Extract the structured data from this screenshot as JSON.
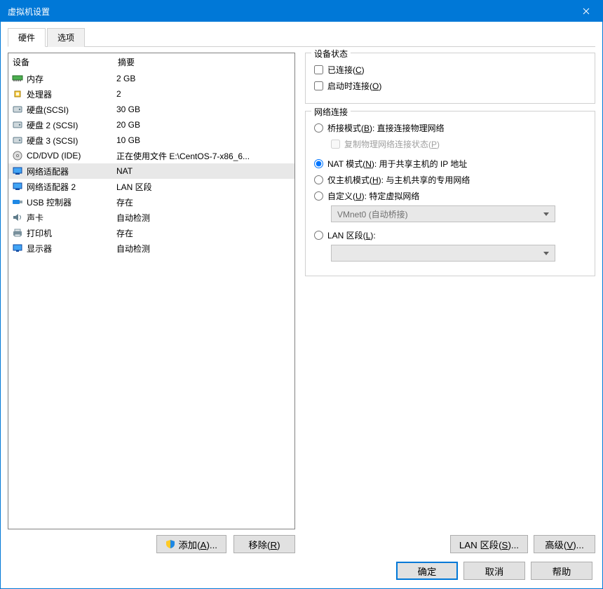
{
  "window": {
    "title": "虚拟机设置"
  },
  "tabs": {
    "hardware": "硬件",
    "options": "选项"
  },
  "list": {
    "header_device": "设备",
    "header_summary": "摘要",
    "rows": [
      {
        "icon": "memory",
        "device": "内存",
        "summary": "2 GB"
      },
      {
        "icon": "cpu",
        "device": "处理器",
        "summary": "2"
      },
      {
        "icon": "disk",
        "device": "硬盘(SCSI)",
        "summary": "30 GB"
      },
      {
        "icon": "disk",
        "device": "硬盘 2 (SCSI)",
        "summary": "20 GB"
      },
      {
        "icon": "disk",
        "device": "硬盘 3 (SCSI)",
        "summary": "10 GB"
      },
      {
        "icon": "cd",
        "device": "CD/DVD (IDE)",
        "summary": "正在使用文件 E:\\CentOS-7-x86_6..."
      },
      {
        "icon": "net",
        "device": "网络适配器",
        "summary": "NAT"
      },
      {
        "icon": "net",
        "device": "网络适配器 2",
        "summary": "LAN 区段"
      },
      {
        "icon": "usb",
        "device": "USB 控制器",
        "summary": "存在"
      },
      {
        "icon": "sound",
        "device": "声卡",
        "summary": "自动检测"
      },
      {
        "icon": "printer",
        "device": "打印机",
        "summary": "存在"
      },
      {
        "icon": "display",
        "device": "显示器",
        "summary": "自动检测"
      }
    ],
    "selected_index": 6
  },
  "left_buttons": {
    "add": "添加(A)...",
    "remove": "移除(R)"
  },
  "device_status": {
    "title": "设备状态",
    "connected": "已连接(C)",
    "connect_at_power_on": "启动时连接(O)"
  },
  "network": {
    "title": "网络连接",
    "bridged": "桥接模式(B): 直接连接物理网络",
    "replicate": "复制物理网络连接状态(P)",
    "nat": "NAT 模式(N): 用于共享主机的 IP 地址",
    "host_only": "仅主机模式(H): 与主机共享的专用网络",
    "custom": "自定义(U): 特定虚拟网络",
    "custom_select": "VMnet0 (自动桥接)",
    "lan_segment": "LAN 区段(L):",
    "lan_select": ""
  },
  "right_buttons": {
    "lan_segments": "LAN 区段(S)...",
    "advanced": "高级(V)..."
  },
  "footer": {
    "ok": "确定",
    "cancel": "取消",
    "help": "帮助"
  }
}
